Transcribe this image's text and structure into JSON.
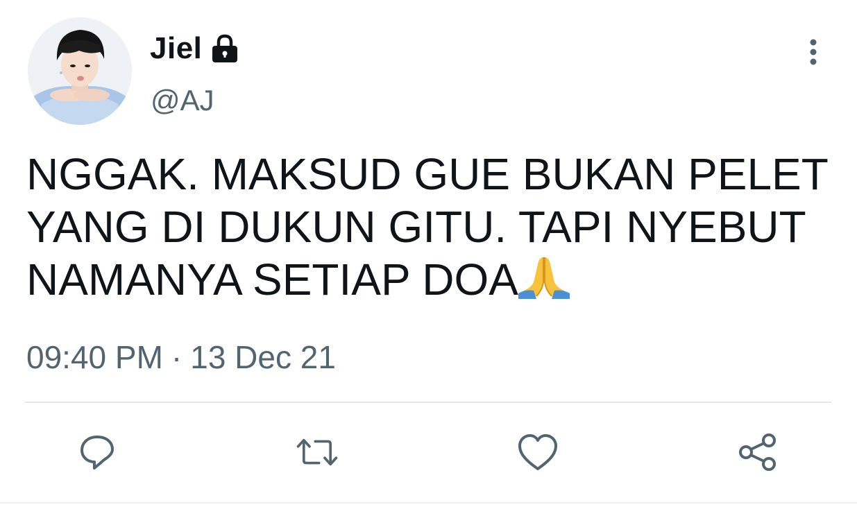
{
  "user": {
    "display_name": "Jiel",
    "handle": "@AJ",
    "protected_icon": "lock-icon",
    "avatar": "profile-photo"
  },
  "tweet": {
    "text": "NGGAK. MAKSUD GUE BUKAN PELET\nYANG DI DUKUN GITU. TAPI NYEBUT\nNAMANYA SETIAP DOA",
    "emoji": "folded-hands-icon"
  },
  "meta": {
    "time": "09:40 PM",
    "separator": "·",
    "date": "13 Dec 21"
  },
  "actions": [
    {
      "name": "reply",
      "icon": "reply-icon"
    },
    {
      "name": "retweet",
      "icon": "retweet-icon"
    },
    {
      "name": "like",
      "icon": "heart-icon"
    },
    {
      "name": "share",
      "icon": "share-icon"
    }
  ],
  "colors": {
    "text_primary": "#0f1419",
    "text_secondary": "#536471",
    "icon_gray": "#536471",
    "divider": "#e4e8eb"
  }
}
